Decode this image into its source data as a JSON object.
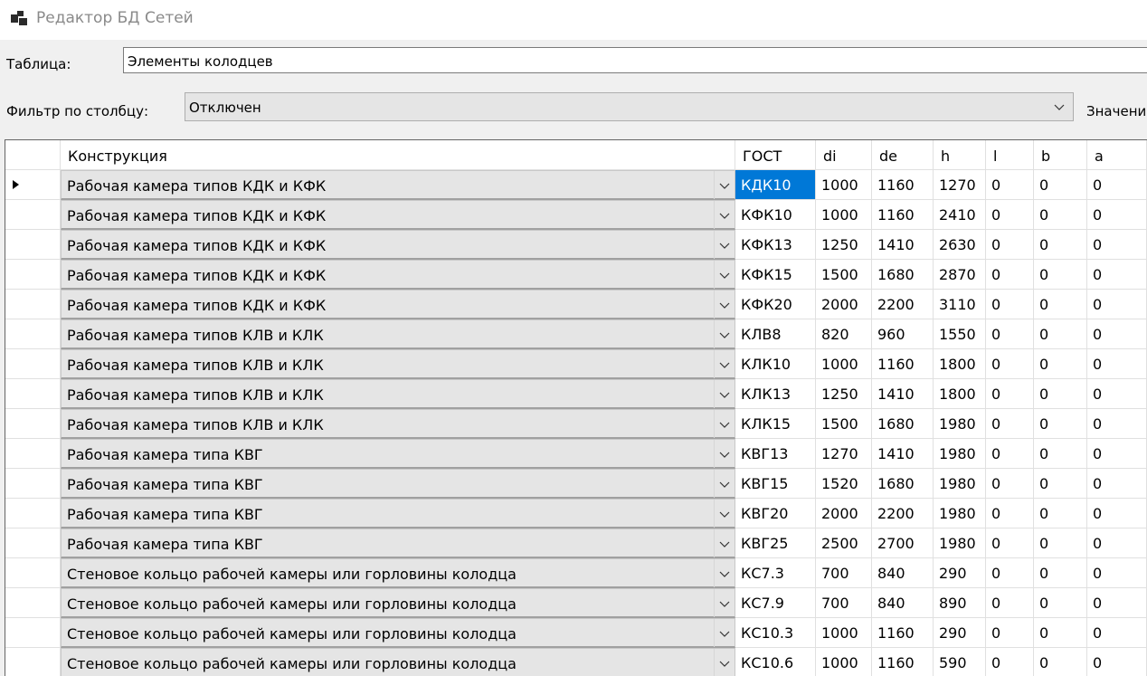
{
  "window": {
    "title": "Редактор БД Сетей",
    "icon": "app-windows-icon"
  },
  "form": {
    "table_label": "Таблица:",
    "table_value": "Элементы колодцев",
    "filter_label": "Фильтр по столбцу:",
    "filter_value": "Отключен",
    "value_label": "Значени"
  },
  "grid": {
    "columns": [
      "",
      "Конструкция",
      "ГОСТ",
      "di",
      "de",
      "h",
      "l",
      "b",
      "a"
    ],
    "rows": [
      {
        "construction": "Рабочая камера типов КДК и КФК",
        "gost": "КДК10",
        "di": "1000",
        "de": "1160",
        "h": "1270",
        "l": "0",
        "b": "0",
        "a": "0",
        "current": true
      },
      {
        "construction": "Рабочая камера типов КДК и КФК",
        "gost": "КФК10",
        "di": "1000",
        "de": "1160",
        "h": "2410",
        "l": "0",
        "b": "0",
        "a": "0"
      },
      {
        "construction": "Рабочая камера типов КДК и КФК",
        "gost": "КФК13",
        "di": "1250",
        "de": "1410",
        "h": "2630",
        "l": "0",
        "b": "0",
        "a": "0"
      },
      {
        "construction": "Рабочая камера типов КДК и КФК",
        "gost": "КФК15",
        "di": "1500",
        "de": "1680",
        "h": "2870",
        "l": "0",
        "b": "0",
        "a": "0"
      },
      {
        "construction": "Рабочая камера типов КДК и КФК",
        "gost": "КФК20",
        "di": "2000",
        "de": "2200",
        "h": "3110",
        "l": "0",
        "b": "0",
        "a": "0"
      },
      {
        "construction": "Рабочая камера типов КЛВ и КЛК",
        "gost": "КЛВ8",
        "di": "820",
        "de": "960",
        "h": "1550",
        "l": "0",
        "b": "0",
        "a": "0"
      },
      {
        "construction": "Рабочая камера типов КЛВ и КЛК",
        "gost": "КЛК10",
        "di": "1000",
        "de": "1160",
        "h": "1800",
        "l": "0",
        "b": "0",
        "a": "0"
      },
      {
        "construction": "Рабочая камера типов КЛВ и КЛК",
        "gost": "КЛК13",
        "di": "1250",
        "de": "1410",
        "h": "1800",
        "l": "0",
        "b": "0",
        "a": "0"
      },
      {
        "construction": "Рабочая камера типов КЛВ и КЛК",
        "gost": "КЛК15",
        "di": "1500",
        "de": "1680",
        "h": "1980",
        "l": "0",
        "b": "0",
        "a": "0"
      },
      {
        "construction": "Рабочая камера типа КВГ",
        "gost": "КВГ13",
        "di": "1270",
        "de": "1410",
        "h": "1980",
        "l": "0",
        "b": "0",
        "a": "0"
      },
      {
        "construction": "Рабочая камера типа КВГ",
        "gost": "КВГ15",
        "di": "1520",
        "de": "1680",
        "h": "1980",
        "l": "0",
        "b": "0",
        "a": "0"
      },
      {
        "construction": "Рабочая камера типа КВГ",
        "gost": "КВГ20",
        "di": "2000",
        "de": "2200",
        "h": "1980",
        "l": "0",
        "b": "0",
        "a": "0"
      },
      {
        "construction": "Рабочая камера типа КВГ",
        "gost": "КВГ25",
        "di": "2500",
        "de": "2700",
        "h": "1980",
        "l": "0",
        "b": "0",
        "a": "0"
      },
      {
        "construction": "Стеновое кольцо рабочей камеры или горловины колодца",
        "gost": "КС7.3",
        "di": "700",
        "de": "840",
        "h": "290",
        "l": "0",
        "b": "0",
        "a": "0"
      },
      {
        "construction": "Стеновое кольцо рабочей камеры или горловины колодца",
        "gost": "КС7.9",
        "di": "700",
        "de": "840",
        "h": "890",
        "l": "0",
        "b": "0",
        "a": "0"
      },
      {
        "construction": "Стеновое кольцо рабочей камеры или горловины колодца",
        "gost": "КС10.3",
        "di": "1000",
        "de": "1160",
        "h": "290",
        "l": "0",
        "b": "0",
        "a": "0"
      },
      {
        "construction": "Стеновое кольцо рабочей камеры или горловины колодца",
        "gost": "КС10.6",
        "di": "1000",
        "de": "1160",
        "h": "590",
        "l": "0",
        "b": "0",
        "a": "0"
      }
    ]
  },
  "colors": {
    "selection": "#0078d7",
    "combo_bg": "#e5e5e5",
    "window_bg": "#f0f0f0"
  }
}
